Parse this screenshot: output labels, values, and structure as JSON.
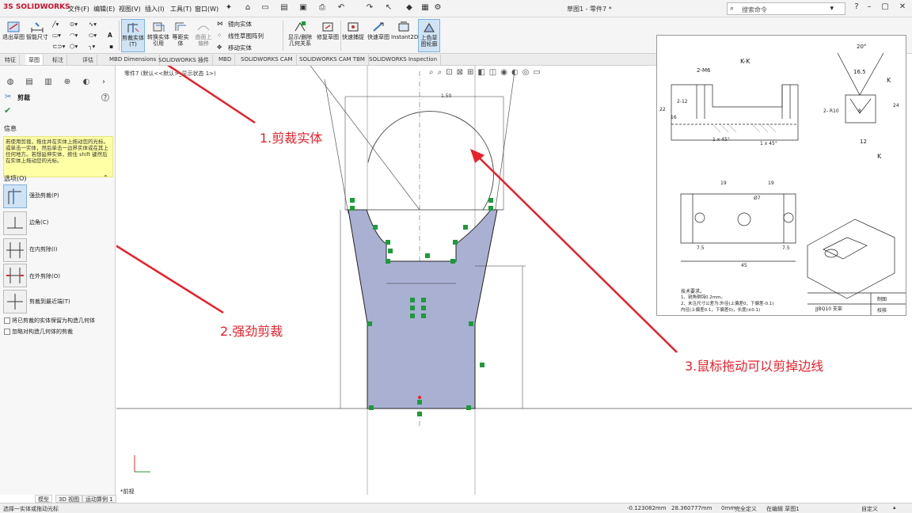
{
  "app": {
    "brand": "SOLIDWORKS",
    "brand_prefix": "3S",
    "doc_title": "草图1 - 零件7 *"
  },
  "menu": [
    "文件(F)",
    "编辑(E)",
    "视图(V)",
    "插入(I)",
    "工具(T)",
    "窗口(W)"
  ],
  "search": {
    "placeholder": "搜索命令"
  },
  "toolbar": {
    "exit_sketch": "退出草图",
    "smart_dimension": "智能尺寸",
    "trim_entities": "剪裁实体(T)",
    "convert_entities": "转换实体引用",
    "offset_entities": "等距实体",
    "surface_offset": "曲面上偏移",
    "mirror_entities": "镜向实体",
    "linear_pattern": "线性草图阵列",
    "move_entities": "移动实体",
    "display_relations": "显示/删除几何关系",
    "repair_sketch": "修复草图",
    "quick_snaps": "快速捕捉",
    "rapid_sketch": "快速草图",
    "instant2d": "Instant2D",
    "shaded_contours": "上色草图轮廓"
  },
  "tabs": [
    "特征",
    "草图",
    "标注",
    "评估",
    "MBD Dimensions",
    "SOLIDWORKS 插件",
    "MBD",
    "SOLIDWORKS CAM",
    "SOLIDWORKS CAM TBM",
    "SOLIDWORKS Inspection"
  ],
  "panel": {
    "title": "剪裁",
    "message_header": "信息",
    "message": "若使用剪裁，拖住并在实体上拖动您的光标。或单击一实体，然后单击一边界实体或在其上任何地方。若想延伸实体，按住 shift 键然后在实体上拖动您的光标。",
    "options_header": "选项(O)",
    "options": [
      "强劲剪裁(P)",
      "边角(C)",
      "在内剪除(I)",
      "在外剪除(O)",
      "剪裁到最近端(T)"
    ],
    "checks": [
      "将已剪裁的实体保留为构造几何体",
      "忽略对构造几何体的剪裁"
    ]
  },
  "canvas": {
    "breadcrumb": "零件7 (默认<<默认>_显示状态 1>)",
    "view_label": "*前视",
    "dim_top": "1.50"
  },
  "annotations": {
    "a1": "1.剪裁实体",
    "a2": "2.强劲剪裁",
    "a3": "3.鼠标拖动可以剪掉边线"
  },
  "sheet": {
    "section": "K-K",
    "dims": [
      "2-M6",
      "2-12",
      "16",
      "22",
      "1 x 45°",
      "1 x 45°",
      "20°",
      "16.5",
      "2- R10",
      "8",
      "12",
      "24",
      "K",
      "K",
      "19",
      "19",
      "Ø7",
      "7.5",
      "7.5",
      "45"
    ],
    "notes_title": "技术要求。",
    "notes": [
      "1、锐角倒钝0.2mm。",
      "2、未注尺寸公差为:外径(上偏差0，下偏差-0.1)",
      "内径(上偏差0.1，下偏差0)，长度(±0.1)"
    ],
    "title_block": {
      "part": "JJBQ10 支架",
      "drawn": "制图",
      "checked": "校核"
    }
  },
  "bottom_tabs": [
    "模型",
    "3D 视图",
    "运动算例 1"
  ],
  "status": {
    "hint": "选择一实体或拖动光标",
    "x": "-0.123082mm",
    "y": "28.360777mm",
    "z": "0mm",
    "defined": "完全定义",
    "editing": "在编辑 草图1",
    "custom": "自定义"
  }
}
